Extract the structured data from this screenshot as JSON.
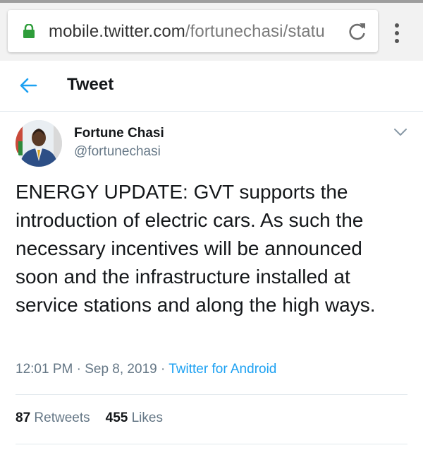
{
  "browser": {
    "url_host": "mobile.twitter.com",
    "url_path": "/fortunechasi/statu",
    "icons": {
      "lock": "lock-icon",
      "reload": "reload-icon",
      "menu": "more-vert-icon"
    },
    "colors": {
      "lock": "#2e9d3a"
    }
  },
  "header": {
    "title": "Tweet",
    "back_icon": "arrow-left-icon",
    "accent": "#1da1f2"
  },
  "tweet": {
    "author_name": "Fortune Chasi",
    "author_handle": "@fortunechasi",
    "text": "ENERGY UPDATE: GVT supports the introduction of electric cars. As such the necessary incentives will be announced soon and the infrastructure installed at service stations and along the high ways.",
    "time": "12:01 PM",
    "date": "Sep 8, 2019",
    "source": "Twitter for Android",
    "separator": "·",
    "retweets_count": "87",
    "retweets_label": "Retweets",
    "likes_count": "455",
    "likes_label": "Likes"
  }
}
